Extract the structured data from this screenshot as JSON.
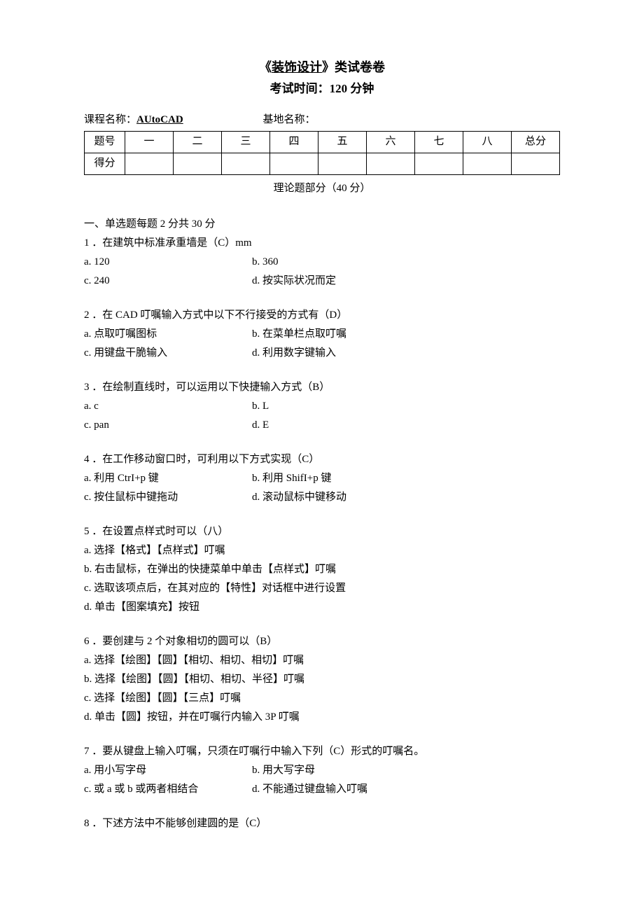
{
  "title": {
    "pre": "《",
    "underlined": "装饰设计",
    "post": "》类试卷卷",
    "sub": "考试时间：120 分钟"
  },
  "meta": {
    "course_label": "课程名称：",
    "course_value": "AUtoCAD",
    "base_label": "基地名称："
  },
  "score_table": {
    "row1": [
      "题号",
      "一",
      "二",
      "三",
      "四",
      "五",
      "六",
      "七",
      "八",
      "总分"
    ],
    "row2_label": "得分"
  },
  "theory_header": "理论题部分（40 分）",
  "section1_header": "一、单选题每题 2 分共 30 分",
  "q1": {
    "stem": "1 ．在建筑中标准承重墙是（C）mm",
    "a": "a. 120",
    "b": "b.  360",
    "c": "c. 240",
    "d": "d. 按实际状况而定"
  },
  "q2": {
    "stem": "2 ．在 CAD 叮嘱输入方式中以下不行接受的方式有（D）",
    "a": "a. 点取叮嘱图标",
    "b": "b. 在菜单栏点取叮嘱",
    "c": "c. 用键盘干脆输入",
    "d": "d. 利用数字键输入"
  },
  "q3": {
    "stem": "3 ．在绘制直线时，可以运用以下快捷输入方式（B）",
    "a": "a. c",
    "b": "b.  L",
    "c": "c. pan",
    "d": "d.  E"
  },
  "q4": {
    "stem": "4 ．在工作移动窗口时，可利用以下方式实现（C）",
    "a": "a. 利用 CtrI+p 键",
    "b": "b. 利用 ShifI+p 键",
    "c": "c. 按住鼠标中键拖动",
    "d": "d. 滚动鼠标中键移动"
  },
  "q5": {
    "stem": "5 ．在设置点样式时可以（八）",
    "a": "a. 选择【格式】【点样式】叮嘱",
    "b": "b. 右击鼠标，在弹出的快捷菜单中单击【点样式】叮嘱",
    "c": "c. 选取该项点后，在其对应的【特性】对话框中进行设置",
    "d": "d. 单击【图案填充】按钮"
  },
  "q6": {
    "stem": "6 ．要创建与 2 个对象相切的圆可以（B）",
    "a": "a. 选择【绘图】【圆】【相切、相切、相切】叮嘱",
    "b": "b. 选择【绘图】【圆】【相切、相切、半径】叮嘱",
    "c": "c. 选择【绘图】【圆】【三点】叮嘱",
    "d": "d. 单击【圆】按钮，并在叮嘱行内输入 3P 叮嘱"
  },
  "q7": {
    "stem": "7 ．要从键盘上输入叮嘱，只须在叮嘱行中输入下列（C）形式的叮嘱名。",
    "a": "a. 用小写字母",
    "b": "b. 用大写字母",
    "c": "c. 或 a 或 b 或两者相结合",
    "d": "d. 不能通过键盘输入叮嘱"
  },
  "q8": {
    "stem": "8 ．下述方法中不能够创建圆的是（C）"
  }
}
